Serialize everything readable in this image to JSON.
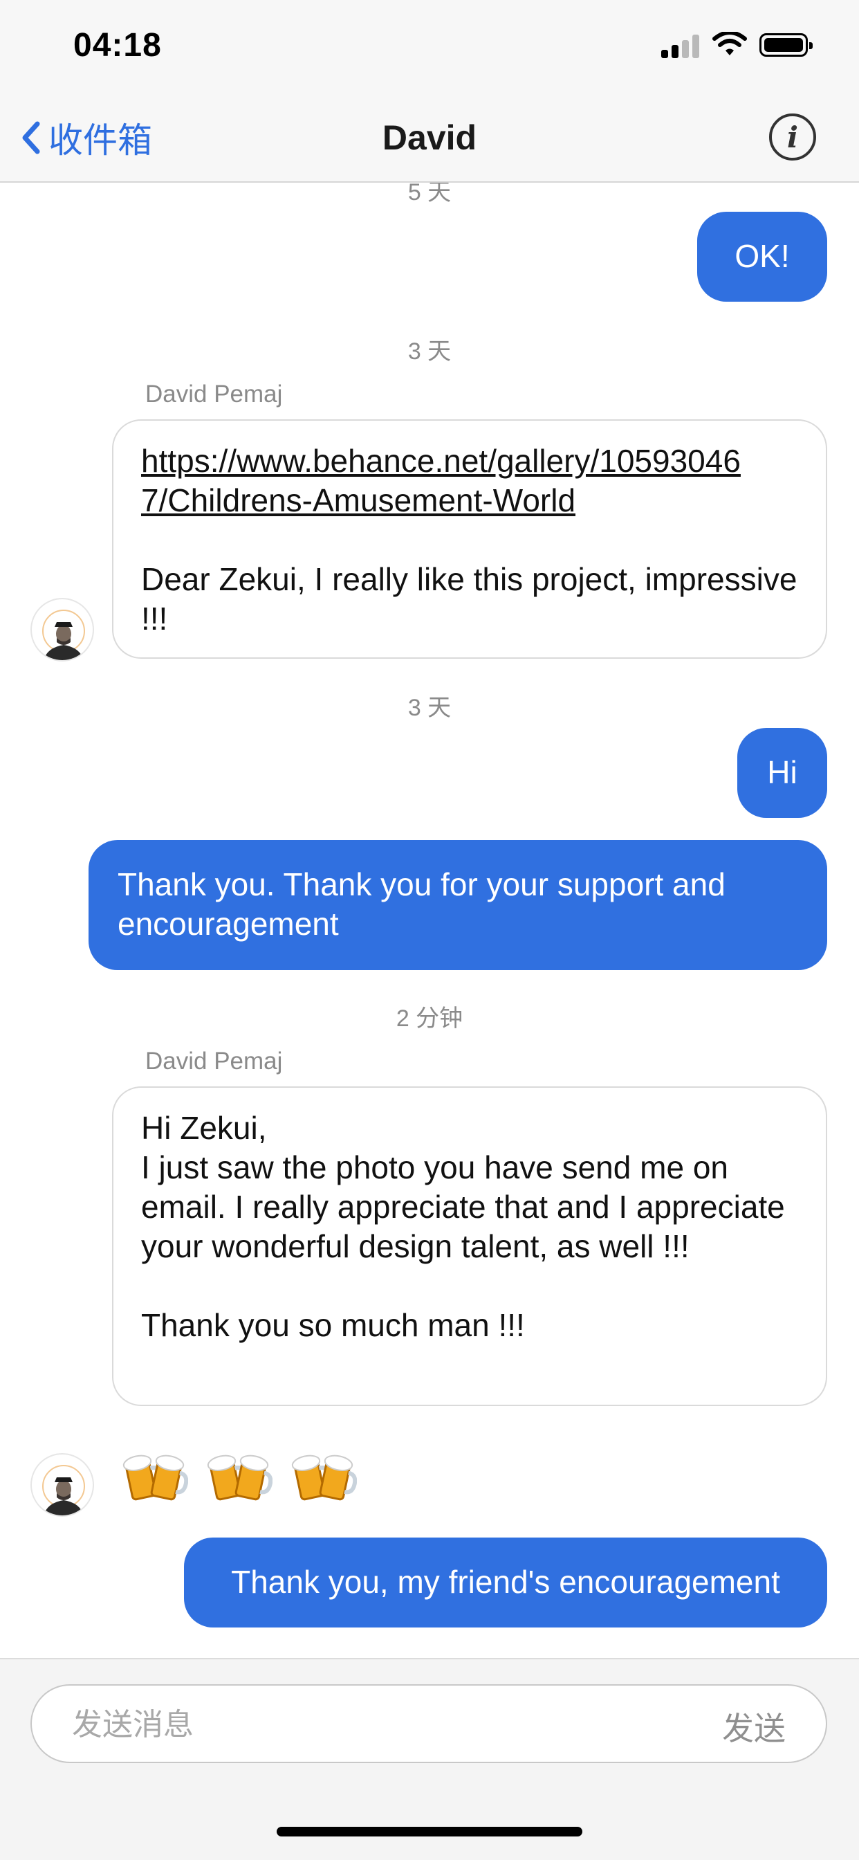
{
  "status_bar": {
    "time": "04:18"
  },
  "nav": {
    "back_label": "收件箱",
    "title": "David",
    "info_icon": "info-icon"
  },
  "messages": {
    "ts_top": "5 天",
    "out_ok": "OK!",
    "ts_1": "3 天",
    "sender_1": "David Pemaj",
    "in_1_link": "https://www.behance.net/gallery/105930467/Childrens-Amusement-World",
    "in_1_text": "Dear Zekui, I really like this project, impressive !!!",
    "ts_2": "3 天",
    "out_hi": "Hi",
    "out_thanks": "Thank you. Thank you for your support and encouragement",
    "ts_3": "2 分钟",
    "sender_2": "David Pemaj",
    "in_2_p1": "Hi Zekui,\nI just saw the photo you have send me on email. I really appreciate that and I appreciate your wonderful design talent, as well !!!",
    "in_2_p2": "Thank you so much man !!!",
    "in_3_emoji": [
      "clinking-beer-mugs",
      "clinking-beer-mugs",
      "clinking-beer-mugs"
    ],
    "out_last": "Thank you, my friend's encouragement"
  },
  "composer": {
    "placeholder": "发送消息",
    "send_label": "发送"
  },
  "colors": {
    "accent": "#3070e0",
    "bubble_in_border": "#dadada",
    "timestamp": "#8a8a8a"
  }
}
